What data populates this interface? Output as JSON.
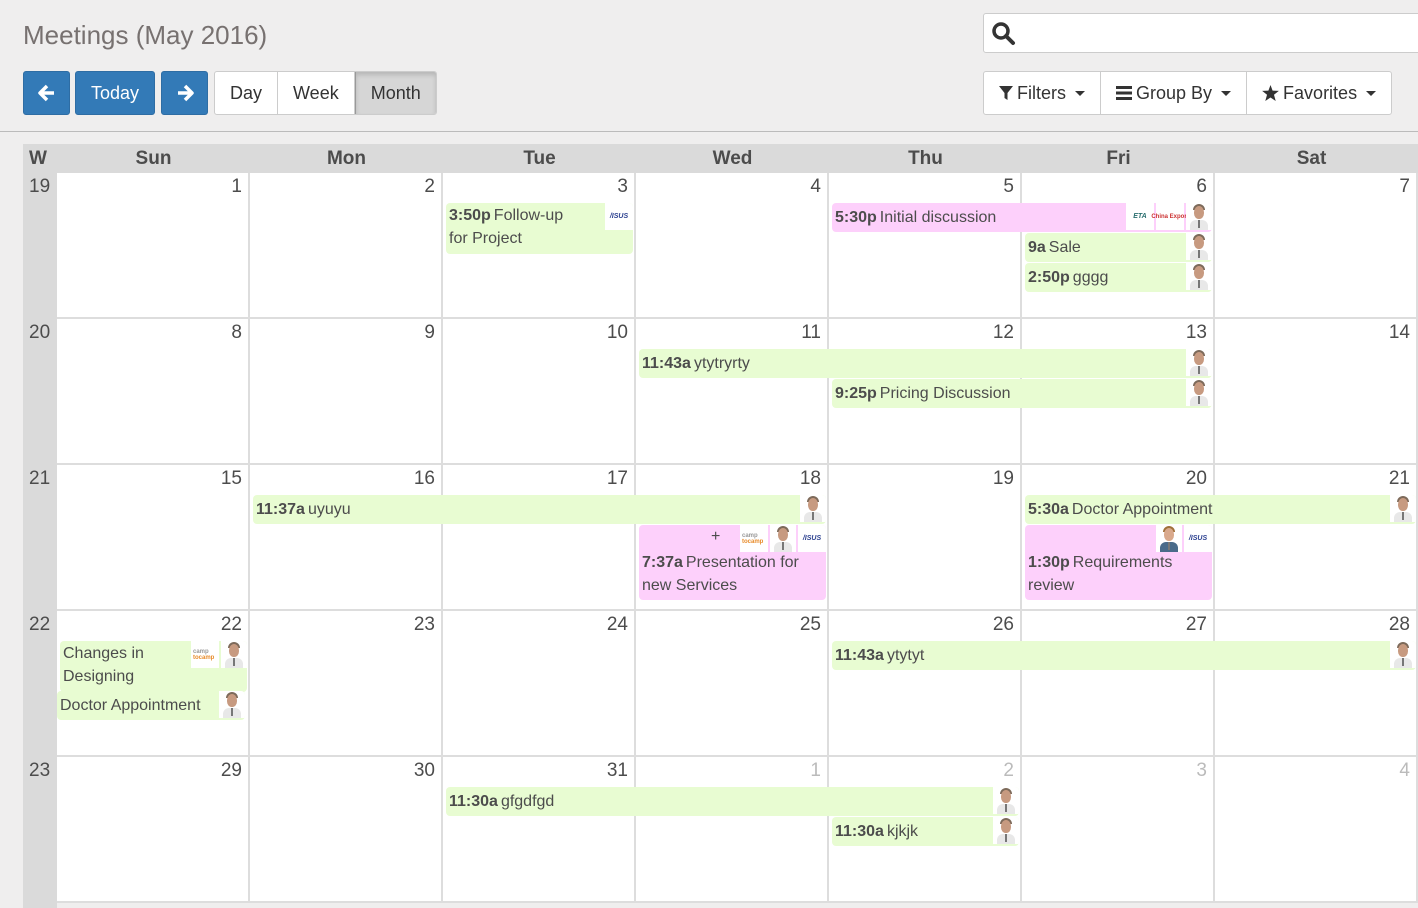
{
  "header": {
    "title": "Meetings (May 2016)"
  },
  "nav": {
    "prev_icon": "arrow-left-icon",
    "today_label": "Today",
    "next_icon": "arrow-right-icon",
    "views": [
      {
        "label": "Day",
        "active": false
      },
      {
        "label": "Week",
        "active": false
      },
      {
        "label": "Month",
        "active": true
      }
    ]
  },
  "search": {
    "icon": "search-icon",
    "value": "",
    "placeholder": ""
  },
  "filters": {
    "filters_label": "Filters",
    "group_by_label": "Group By",
    "favorites_label": "Favorites"
  },
  "calendar": {
    "week_header": "W",
    "day_headers": [
      "Sun",
      "Mon",
      "Tue",
      "Wed",
      "Thu",
      "Fri",
      "Sat"
    ],
    "weeks": [
      {
        "number": "19",
        "days": [
          "1",
          "2",
          "3",
          "4",
          "5",
          "6",
          "7"
        ]
      },
      {
        "number": "20",
        "days": [
          "8",
          "9",
          "10",
          "11",
          "12",
          "13",
          "14"
        ]
      },
      {
        "number": "21",
        "days": [
          "15",
          "16",
          "17",
          "18",
          "19",
          "20",
          "21"
        ]
      },
      {
        "number": "22",
        "days": [
          "22",
          "23",
          "24",
          "25",
          "26",
          "27",
          "28"
        ]
      },
      {
        "number": "23",
        "days": [
          "29",
          "30",
          "31",
          "1",
          "2",
          "3",
          "4"
        ]
      }
    ],
    "other_month_days": [
      "1",
      "2",
      "3",
      "4"
    ],
    "events": [
      {
        "time": "3:50p",
        "title": "Follow-up for Project proposal",
        "color": "green",
        "attendees": [
          "asus-logo"
        ]
      },
      {
        "time": "5:30p",
        "title": "Initial discussion",
        "color": "pink",
        "attendees": [
          "eta-logo",
          "china-export-logo",
          "avatar-man"
        ]
      },
      {
        "time": "9a",
        "title": "Sale",
        "color": "green",
        "attendees": [
          "avatar-man"
        ]
      },
      {
        "time": "2:50p",
        "title": "gggg",
        "color": "green",
        "attendees": [
          "avatar-man"
        ]
      },
      {
        "time": "11:43a",
        "title": "ytytryrty",
        "color": "green",
        "attendees": [
          "avatar-man"
        ]
      },
      {
        "time": "9:25p",
        "title": "Pricing Discussion",
        "color": "green",
        "attendees": [
          "avatar-man"
        ]
      },
      {
        "time": "11:37a",
        "title": "uyuyu",
        "color": "green",
        "attendees": [
          "avatar-man"
        ]
      },
      {
        "time": "7:37a",
        "title": "Presentation for new Services",
        "color": "pink",
        "more": "+",
        "attendees": [
          "camptocamp-logo",
          "avatar-man",
          "asus-logo"
        ]
      },
      {
        "time": "5:30a",
        "title": "Doctor Appointment",
        "color": "green",
        "attendees": [
          "avatar-man"
        ]
      },
      {
        "time": "1:30p",
        "title": "Requirements review",
        "color": "pink",
        "attendees": [
          "avatar-young-man",
          "asus-logo"
        ]
      },
      {
        "time": "",
        "title": "Changes in Designing",
        "color": "green",
        "attendees": [
          "camptocamp-logo",
          "avatar-man"
        ]
      },
      {
        "time": "",
        "title": "Doctor Appointment",
        "color": "green",
        "attendees": [
          "avatar-man"
        ]
      },
      {
        "time": "11:43a",
        "title": "ytytyt",
        "color": "green",
        "attendees": [
          "avatar-man"
        ]
      },
      {
        "time": "11:30a",
        "title": "gfgdfgd",
        "color": "green",
        "attendees": [
          "avatar-man"
        ]
      },
      {
        "time": "11:30a",
        "title": "kjkjk",
        "color": "green",
        "attendees": [
          "avatar-man"
        ]
      }
    ],
    "logos": {
      "asus": "/ISUS",
      "camp": "camp",
      "tocamp": "tocamp",
      "eta": "ETA",
      "china": "China Export"
    },
    "colors": {
      "green": "#e8fcd2",
      "pink": "#fdd0fb",
      "primary": "#337ab7"
    }
  }
}
